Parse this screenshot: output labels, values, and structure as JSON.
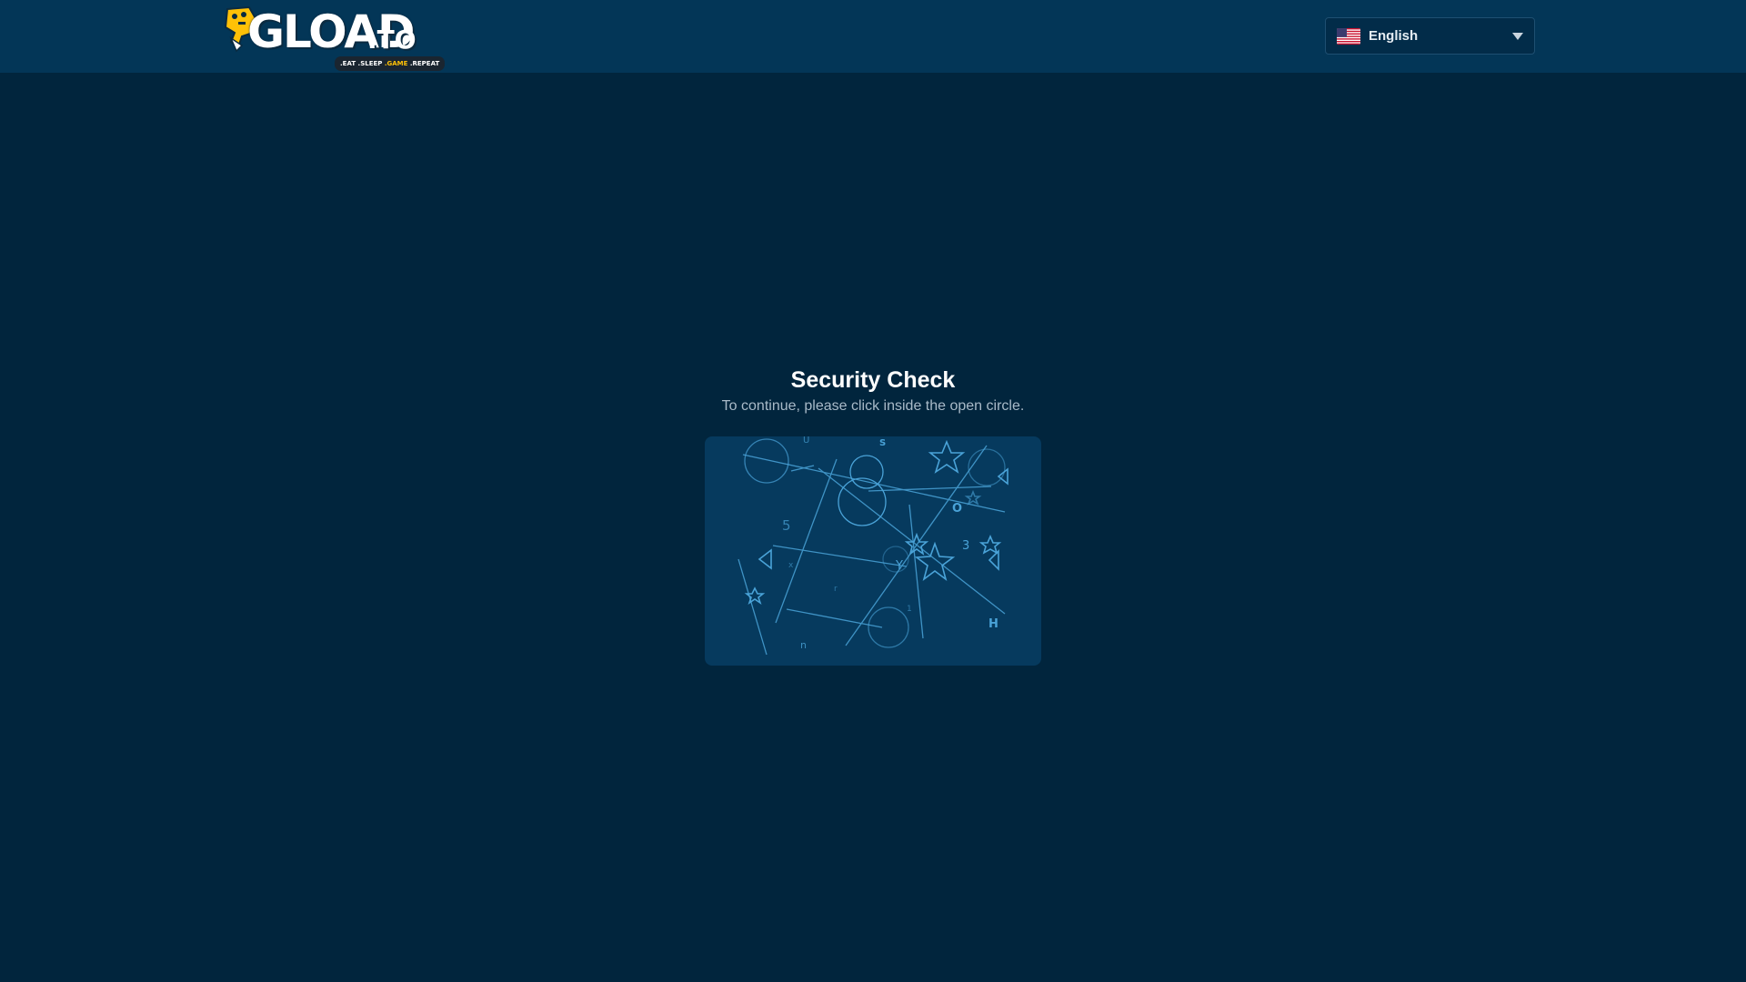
{
  "header": {
    "logo": {
      "text": "GLOAD",
      "suffix": ".TO",
      "tagline_parts": [
        ".EAT",
        ".SLEEP",
        ".GAME",
        ".REPEAT"
      ]
    },
    "language_selector": {
      "selected": "English",
      "flag_icon": "us-flag-icon"
    }
  },
  "main": {
    "title": "Security Check",
    "instruction": "To continue, please click inside the open circle."
  },
  "captcha": {
    "glyphs": [
      "5",
      "Y",
      "H",
      "U",
      "S",
      "O",
      "3",
      "n",
      "x",
      "r",
      "1"
    ]
  },
  "colors": {
    "page_bg": "#01253d",
    "header_bg": "#033657",
    "captcha_bg": "#063a5e",
    "captcha_line": "#4aa3d8",
    "logo_accent": "#ffc107"
  }
}
